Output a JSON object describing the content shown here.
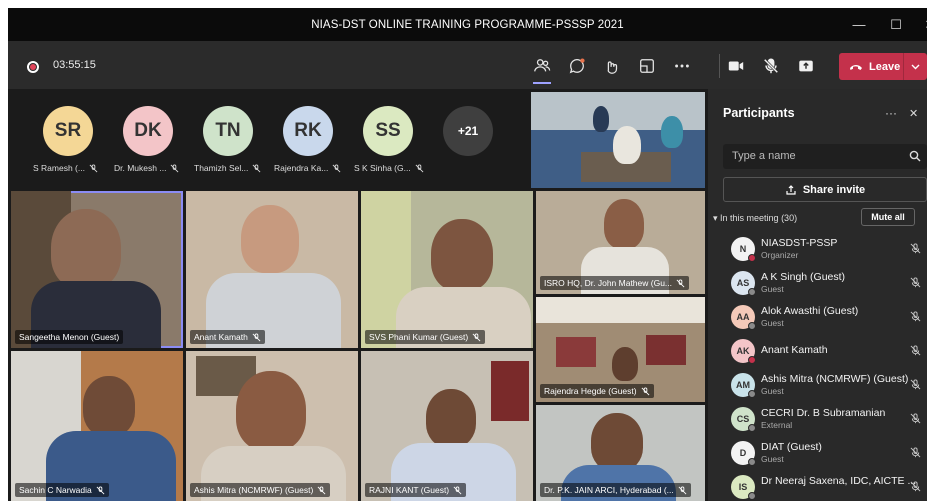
{
  "window": {
    "title": "NIAS-DST ONLINE TRAINING PROGRAMME-PSSSP 2021",
    "minimize": "—",
    "maximize": "☐",
    "close": "✕"
  },
  "toolbar": {
    "timer": "03:55:15",
    "leave_label": "Leave"
  },
  "avatars": [
    {
      "initials": "SR",
      "name": "S Ramesh (...",
      "color": "#f4d796"
    },
    {
      "initials": "DK",
      "name": "Dr. Mukesh ...",
      "color": "#f3c5c8"
    },
    {
      "initials": "TN",
      "name": "Thamizh Sel...",
      "color": "#cfe3ca"
    },
    {
      "initials": "RK",
      "name": "Rajendra Ka...",
      "color": "#c9d8ec"
    },
    {
      "initials": "SS",
      "name": "S K Sinha (G...",
      "color": "#dbe9c1"
    }
  ],
  "overflow_count": "+21",
  "tiles": [
    {
      "name": ""
    },
    {
      "name": "Sangeetha Menon (Guest)"
    },
    {
      "name": "Anant Kamath"
    },
    {
      "name": "SVS Phani Kumar (Guest)"
    },
    {
      "name": "ISRO HQ, Dr. John Mathew (Gu..."
    },
    {
      "name": "Rajendra Hegde (Guest)"
    },
    {
      "name": "Sachin C Narwadia"
    },
    {
      "name": "Ashis Mitra (NCMRWF) (Guest)"
    },
    {
      "name": "RAJNI KANT (Guest)"
    },
    {
      "name": "Dr. P.K. JAIN ARCI, Hyderabad (..."
    }
  ],
  "panel": {
    "title": "Participants",
    "more": "···",
    "close": "✕",
    "search_placeholder": "Type a name",
    "share_label": "Share invite",
    "in_meeting": "In this meeting (30)",
    "mute_all": "Mute all",
    "participants": [
      {
        "initials": "N",
        "name": "NIASDST-PSSP",
        "role": "Organizer",
        "color": "#f3f3f3",
        "status": "#c4314b"
      },
      {
        "initials": "AS",
        "name": "A K Singh (Guest)",
        "role": "Guest",
        "color": "#dce6f0",
        "status": "#8a8a8a"
      },
      {
        "initials": "AA",
        "name": "Alok Awasthi (Guest)",
        "role": "Guest",
        "color": "#f4c9b8",
        "status": "#8a8a8a"
      },
      {
        "initials": "AK",
        "name": "Anant Kamath",
        "role": "",
        "color": "#f3c5c8",
        "status": "#c4314b"
      },
      {
        "initials": "AM",
        "name": "Ashis Mitra (NCMRWF) (Guest)",
        "role": "Guest",
        "color": "#c9e3ea",
        "status": "#8a8a8a"
      },
      {
        "initials": "CS",
        "name": "CECRI Dr. B Subramanian",
        "role": "External",
        "color": "#cfe3ca",
        "status": "#8a8a8a"
      },
      {
        "initials": "D",
        "name": "DIAT (Guest)",
        "role": "Guest",
        "color": "#f3f3f3",
        "status": "#8a8a8a"
      },
      {
        "initials": "IS",
        "name": "Dr Neeraj Saxena, IDC, AICTE ...",
        "role": "",
        "color": "#dbe9c1",
        "status": "#8a8a8a"
      }
    ]
  }
}
